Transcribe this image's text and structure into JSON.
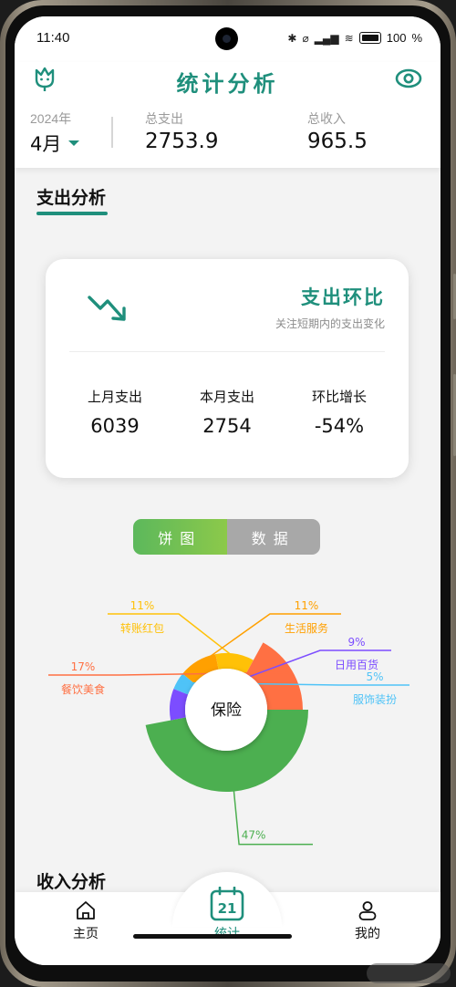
{
  "status_bar": {
    "time": "11:40",
    "battery": "100"
  },
  "header": {
    "title": "统计分析",
    "year": "2024年",
    "month": "4月",
    "expense_label": "总支出",
    "expense_value": "2753.9",
    "income_label": "总收入",
    "income_value": "965.5"
  },
  "expense_section": {
    "title": "支出分析"
  },
  "mom_card": {
    "title": "支出环比",
    "subtitle": "关注短期内的支出变化",
    "stats": [
      {
        "label": "上月支出",
        "value": "6039"
      },
      {
        "label": "本月支出",
        "value": "2754"
      },
      {
        "label": "环比增长",
        "value": "-54%"
      }
    ]
  },
  "view_toggle": {
    "pie_label": "饼图",
    "data_label": "数据",
    "active": "pie"
  },
  "chart_data": {
    "type": "pie",
    "center_label": "保险",
    "slices": [
      {
        "name": "保险",
        "percent": "47%",
        "value": 47,
        "color": "#4caf50"
      },
      {
        "name": "餐饮美食",
        "percent": "17%",
        "value": 17,
        "color": "#ff7043"
      },
      {
        "name": "转账红包",
        "percent": "11%",
        "value": 11,
        "color": "#ffc107"
      },
      {
        "name": "生活服务",
        "percent": "11%",
        "value": 11,
        "color": "#ffa000"
      },
      {
        "name": "日用百货",
        "percent": "9%",
        "value": 9,
        "color": "#7c4dff"
      },
      {
        "name": "服饰装扮",
        "percent": "5%",
        "value": 5,
        "color": "#4fc3f7"
      }
    ]
  },
  "income_section": {
    "title": "收入分析"
  },
  "tabbar": {
    "items": [
      {
        "label": "主页"
      },
      {
        "label": "统计",
        "badge": "21"
      },
      {
        "label": "我的"
      }
    ]
  },
  "colors": {
    "accent": "#1f8f7c"
  }
}
